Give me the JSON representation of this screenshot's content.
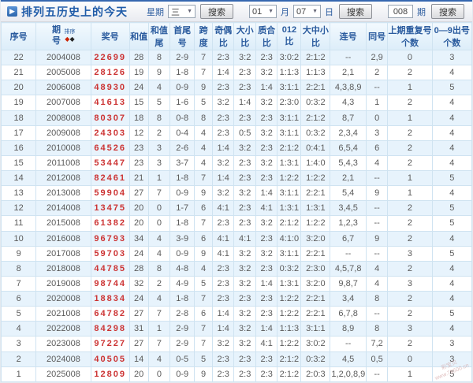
{
  "title_bar": {
    "title": "排列五历史上的今天",
    "week_label": "星期",
    "week_value": "三",
    "month_value": "01",
    "month_label": "月",
    "day_value": "07",
    "day_label": "日",
    "issue_value": "008",
    "issue_label": "期",
    "search_label": "搜索"
  },
  "table": {
    "sort_label": "排序",
    "headers": [
      "序号",
      "期号",
      "奖号",
      "和值",
      "和值尾",
      "首尾号",
      "跨度",
      "奇偶比",
      "大小比",
      "质合比",
      "012比",
      "大中小比",
      "连号",
      "同号",
      "上期重复号个数",
      "0—9出号个数"
    ],
    "rows": [
      [
        "22",
        "2004008",
        "22699",
        "28",
        "8",
        "2-9",
        "7",
        "2:3",
        "3:2",
        "2:3",
        "3:0:2",
        "2:1:2",
        "--",
        "2,9",
        "0",
        "3"
      ],
      [
        "21",
        "2005008",
        "28126",
        "19",
        "9",
        "1-8",
        "7",
        "1:4",
        "2:3",
        "3:2",
        "1:1:3",
        "1:1:3",
        "2,1",
        "2",
        "2",
        "4"
      ],
      [
        "20",
        "2006008",
        "48930",
        "24",
        "4",
        "0-9",
        "9",
        "2:3",
        "2:3",
        "1:4",
        "3:1:1",
        "2:2:1",
        "4,3,8,9",
        "--",
        "1",
        "5"
      ],
      [
        "19",
        "2007008",
        "41613",
        "15",
        "5",
        "1-6",
        "5",
        "3:2",
        "1:4",
        "3:2",
        "2:3:0",
        "0:3:2",
        "4,3",
        "1",
        "2",
        "4"
      ],
      [
        "18",
        "2008008",
        "80307",
        "18",
        "8",
        "0-8",
        "8",
        "2:3",
        "2:3",
        "2:3",
        "3:1:1",
        "2:1:2",
        "8,7",
        "0",
        "1",
        "4"
      ],
      [
        "17",
        "2009008",
        "24303",
        "12",
        "2",
        "0-4",
        "4",
        "2:3",
        "0:5",
        "3:2",
        "3:1:1",
        "0:3:2",
        "2,3,4",
        "3",
        "2",
        "4"
      ],
      [
        "16",
        "2010008",
        "64526",
        "23",
        "3",
        "2-6",
        "4",
        "1:4",
        "3:2",
        "2:3",
        "2:1:2",
        "0:4:1",
        "6,5,4",
        "6",
        "2",
        "4"
      ],
      [
        "15",
        "2011008",
        "53447",
        "23",
        "3",
        "3-7",
        "4",
        "3:2",
        "2:3",
        "3:2",
        "1:3:1",
        "1:4:0",
        "5,4,3",
        "4",
        "2",
        "4"
      ],
      [
        "14",
        "2012008",
        "82461",
        "21",
        "1",
        "1-8",
        "7",
        "1:4",
        "2:3",
        "2:3",
        "1:2:2",
        "1:2:2",
        "2,1",
        "--",
        "1",
        "5"
      ],
      [
        "13",
        "2013008",
        "59904",
        "27",
        "7",
        "0-9",
        "9",
        "3:2",
        "3:2",
        "1:4",
        "3:1:1",
        "2:2:1",
        "5,4",
        "9",
        "1",
        "4"
      ],
      [
        "12",
        "2014008",
        "13475",
        "20",
        "0",
        "1-7",
        "6",
        "4:1",
        "2:3",
        "4:1",
        "1:3:1",
        "1:3:1",
        "3,4,5",
        "--",
        "2",
        "5"
      ],
      [
        "11",
        "2015008",
        "61382",
        "20",
        "0",
        "1-8",
        "7",
        "2:3",
        "2:3",
        "3:2",
        "2:1:2",
        "1:2:2",
        "1,2,3",
        "--",
        "2",
        "5"
      ],
      [
        "10",
        "2016008",
        "96793",
        "34",
        "4",
        "3-9",
        "6",
        "4:1",
        "4:1",
        "2:3",
        "4:1:0",
        "3:2:0",
        "6,7",
        "9",
        "2",
        "4"
      ],
      [
        "9",
        "2017008",
        "59703",
        "24",
        "4",
        "0-9",
        "9",
        "4:1",
        "3:2",
        "3:2",
        "3:1:1",
        "2:2:1",
        "--",
        "--",
        "3",
        "5"
      ],
      [
        "8",
        "2018008",
        "44785",
        "28",
        "8",
        "4-8",
        "4",
        "2:3",
        "3:2",
        "2:3",
        "0:3:2",
        "2:3:0",
        "4,5,7,8",
        "4",
        "2",
        "4"
      ],
      [
        "7",
        "2019008",
        "98744",
        "32",
        "2",
        "4-9",
        "5",
        "2:3",
        "3:2",
        "1:4",
        "1:3:1",
        "3:2:0",
        "9,8,7",
        "4",
        "3",
        "4"
      ],
      [
        "6",
        "2020008",
        "18834",
        "24",
        "4",
        "1-8",
        "7",
        "2:3",
        "2:3",
        "2:3",
        "1:2:2",
        "2:2:1",
        "3,4",
        "8",
        "2",
        "4"
      ],
      [
        "5",
        "2021008",
        "64782",
        "27",
        "7",
        "2-8",
        "6",
        "1:4",
        "3:2",
        "2:3",
        "1:2:2",
        "2:2:1",
        "6,7,8",
        "--",
        "2",
        "5"
      ],
      [
        "4",
        "2022008",
        "84298",
        "31",
        "1",
        "2-9",
        "7",
        "1:4",
        "3:2",
        "1:4",
        "1:1:3",
        "3:1:1",
        "8,9",
        "8",
        "3",
        "4"
      ],
      [
        "3",
        "2023008",
        "97227",
        "27",
        "7",
        "2-9",
        "7",
        "3:2",
        "3:2",
        "4:1",
        "1:2:2",
        "3:0:2",
        "--",
        "7,2",
        "2",
        "3"
      ],
      [
        "2",
        "2024008",
        "40505",
        "14",
        "4",
        "0-5",
        "5",
        "2:3",
        "2:3",
        "2:3",
        "2:1:2",
        "0:3:2",
        "4,5",
        "0,5",
        "0",
        "3"
      ],
      [
        "1",
        "2025008",
        "12809",
        "20",
        "0",
        "0-9",
        "9",
        "2:3",
        "2:3",
        "2:3",
        "2:1:2",
        "2:0:3",
        "1,2,0,8,9",
        "--",
        "1",
        "5"
      ]
    ]
  },
  "watermark": {
    "brand": "彩宝贝",
    "site": "www.78500.cn"
  },
  "colors": {
    "accent_blue": "#2a5b9e",
    "top_line": "#3567b0",
    "prize_red": "#cc3333",
    "row_alt": "#e7f3fc",
    "table_border": "#cfe3f1"
  }
}
